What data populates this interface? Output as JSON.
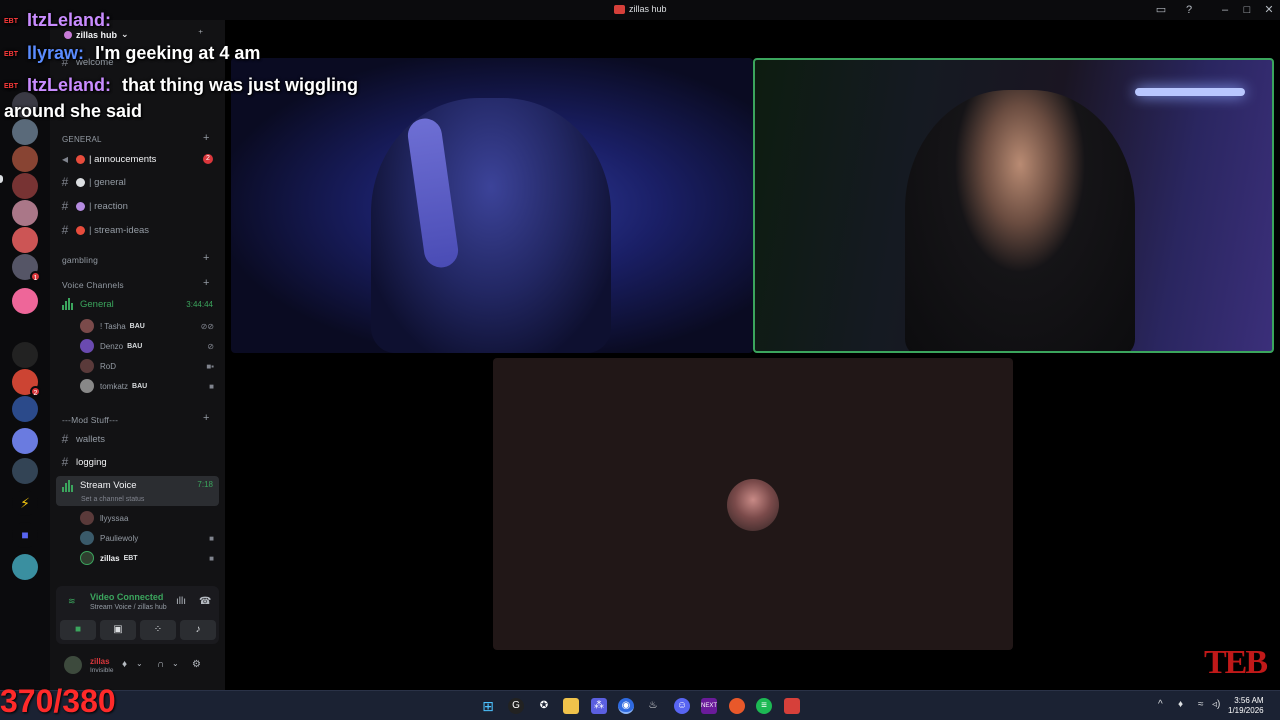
{
  "window": {
    "title": "zillas hub"
  },
  "server": {
    "name": "zillas hub"
  },
  "categories": {
    "general": "GENERAL",
    "gambling": "gambling",
    "voice": "Voice Channels",
    "mod": "---Mod Stuff---"
  },
  "channels": {
    "welcome": "welcome",
    "announcements": "| annoucements",
    "announcements_badge": "2",
    "general": "| general",
    "reaction": "| reaction",
    "stream_ideas": "| stream-ideas",
    "voice_general": "General",
    "voice_general_timer": "3:44:44",
    "wallets": "wallets",
    "logging": "logging",
    "stream_voice": "Stream Voice",
    "stream_voice_timer": "7:18",
    "stream_voice_status": "Set a channel status"
  },
  "general_members": [
    {
      "name": "! Tasha",
      "tag": "BAU"
    },
    {
      "name": "Denzo",
      "tag": "BAU"
    },
    {
      "name": "RoD",
      "tag": ""
    },
    {
      "name": "tomkatz",
      "tag": "BAU"
    }
  ],
  "stream_members": [
    {
      "name": "llyyssaa",
      "tag": ""
    },
    {
      "name": "Pauliewoly",
      "tag": ""
    },
    {
      "name": "zillas",
      "tag": "EBT"
    }
  ],
  "voice_panel": {
    "status": "Video Connected",
    "location": "Stream Voice / zillas hub"
  },
  "user": {
    "name": "zillas",
    "status": "Invisible"
  },
  "chat": [
    {
      "badge": "EBT",
      "nick": "ItzLeland:",
      "text": "",
      "nick_color": "#c98cff"
    },
    {
      "badge": "EBT",
      "nick": "llyraw:",
      "text": "I'm geeking at 4 am",
      "nick_color": "#5b8cff"
    },
    {
      "badge": "EBT",
      "nick": "ItzLeland:",
      "text": "that thing was just wiggling",
      "nick_color": "#c98cff"
    },
    {
      "badge": "",
      "nick": "",
      "text": "around she said",
      "nick_color": "#ffffff"
    }
  ],
  "overlay": {
    "counter": "370/380",
    "logo": "TEB"
  },
  "taskbar": {
    "time": "3:56 AM",
    "date": "1/19/2026"
  },
  "colors": {
    "voice_green": "#3ba55d",
    "alert_red": "#da373c",
    "counter_red": "#ff2a2a"
  }
}
